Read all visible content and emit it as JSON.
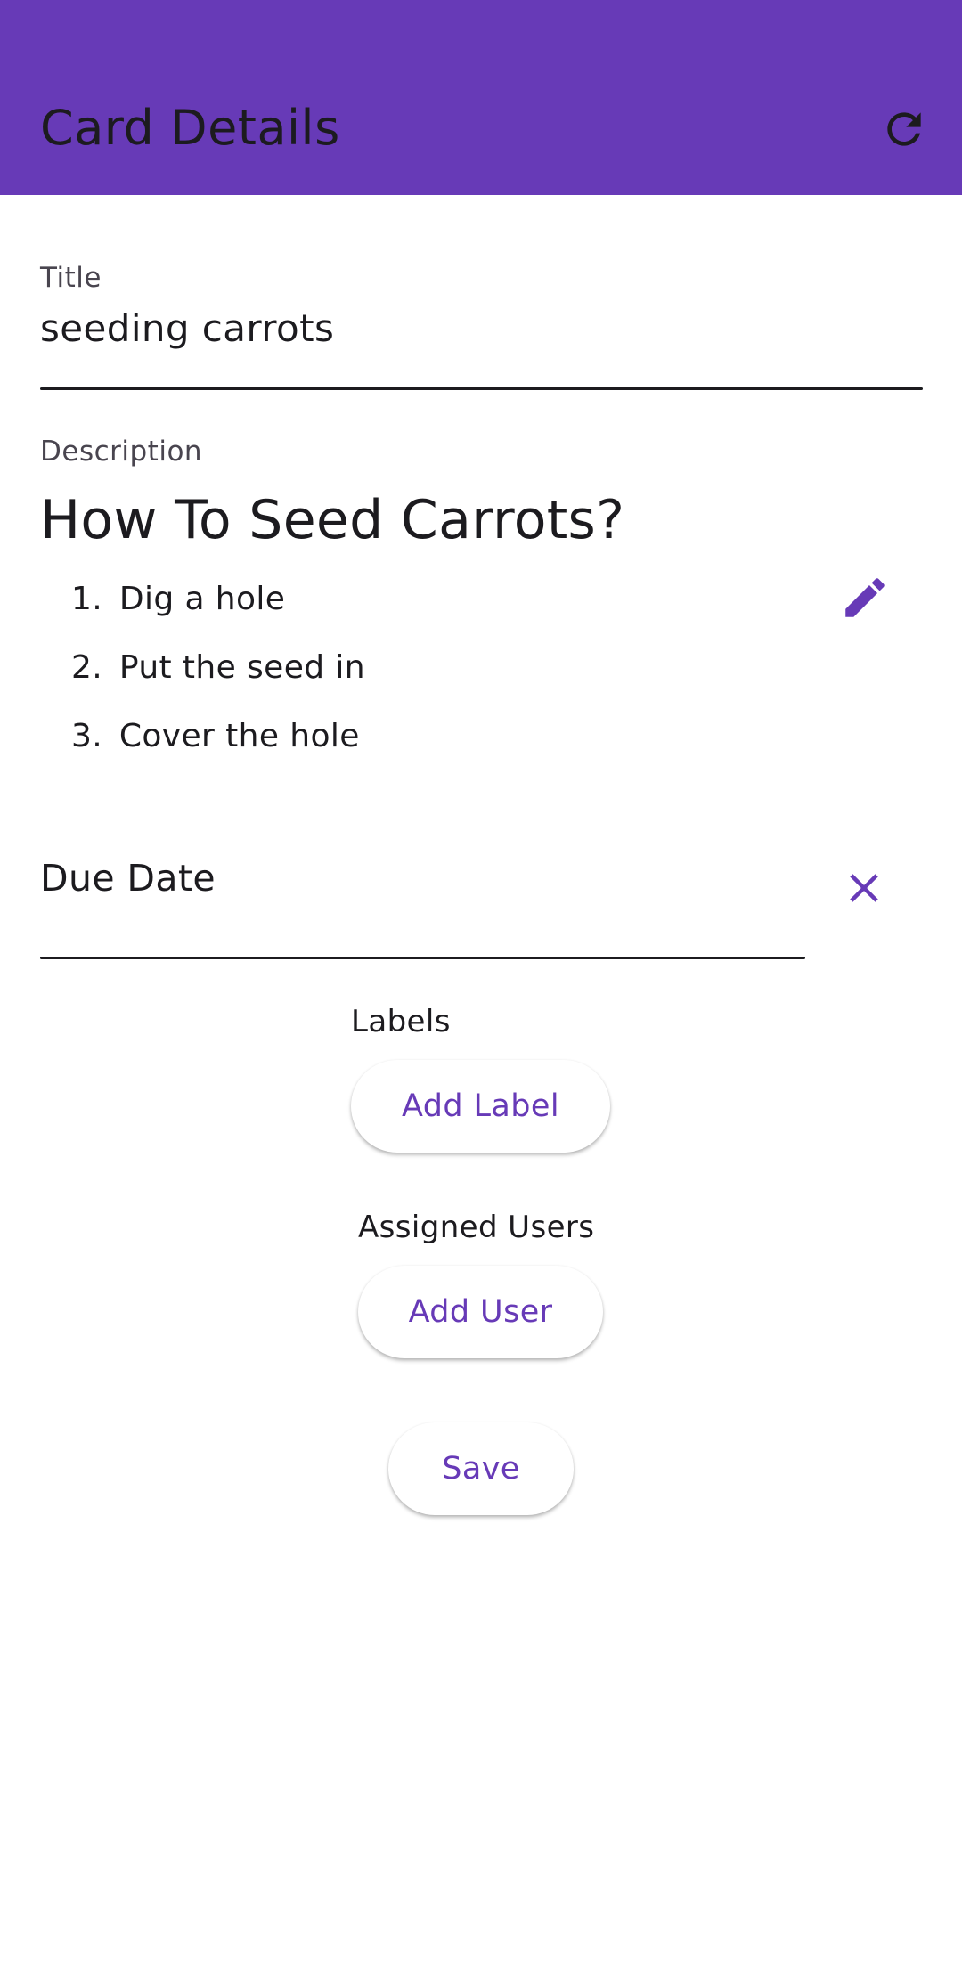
{
  "app_bar": {
    "title": "Card Details",
    "refresh_icon": "refresh-icon",
    "background_color": "#673ab7"
  },
  "title_field": {
    "label": "Title",
    "value": "seeding carrots"
  },
  "description": {
    "label": "Description",
    "heading": "How To Seed Carrots?",
    "steps": [
      {
        "num": "1.",
        "text": "Dig a hole"
      },
      {
        "num": "2.",
        "text": "Put the seed in"
      },
      {
        "num": "3.",
        "text": "Cover the hole"
      }
    ],
    "edit_icon": "pencil-icon"
  },
  "due_date": {
    "placeholder": "Due Date",
    "clear_icon": "close-icon"
  },
  "labels": {
    "label": "Labels",
    "add_button": "Add Label"
  },
  "users": {
    "label": "Assigned Users",
    "add_button": "Add User"
  },
  "save_button": "Save",
  "accent_color": "#673ab7"
}
